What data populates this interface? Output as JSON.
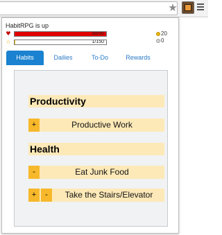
{
  "browser": {
    "star_icon": "★",
    "menu_icon": "menu-icon"
  },
  "status": {
    "text": "HabitRPG is up"
  },
  "hp": {
    "label": "50/50",
    "fraction": 1.0,
    "color": "#e00000"
  },
  "xp": {
    "label": "1/150",
    "fraction": 0.0067,
    "color": "#f2c200"
  },
  "currency": {
    "gold": "20",
    "silver": "0"
  },
  "tabs": [
    {
      "label": "Habits",
      "active": true
    },
    {
      "label": "Dailies",
      "active": false
    },
    {
      "label": "To-Do",
      "active": false
    },
    {
      "label": "Rewards",
      "active": false
    }
  ],
  "sections": [
    {
      "title": "Productivity",
      "tasks": [
        {
          "name": "Productive Work",
          "up": "+",
          "down": ""
        }
      ]
    },
    {
      "title": "Health",
      "tasks": [
        {
          "name": "Eat Junk Food",
          "up": "",
          "down": "-"
        },
        {
          "name": "Take the Stairs/Elevator",
          "up": "+",
          "down": "-"
        }
      ]
    }
  ]
}
